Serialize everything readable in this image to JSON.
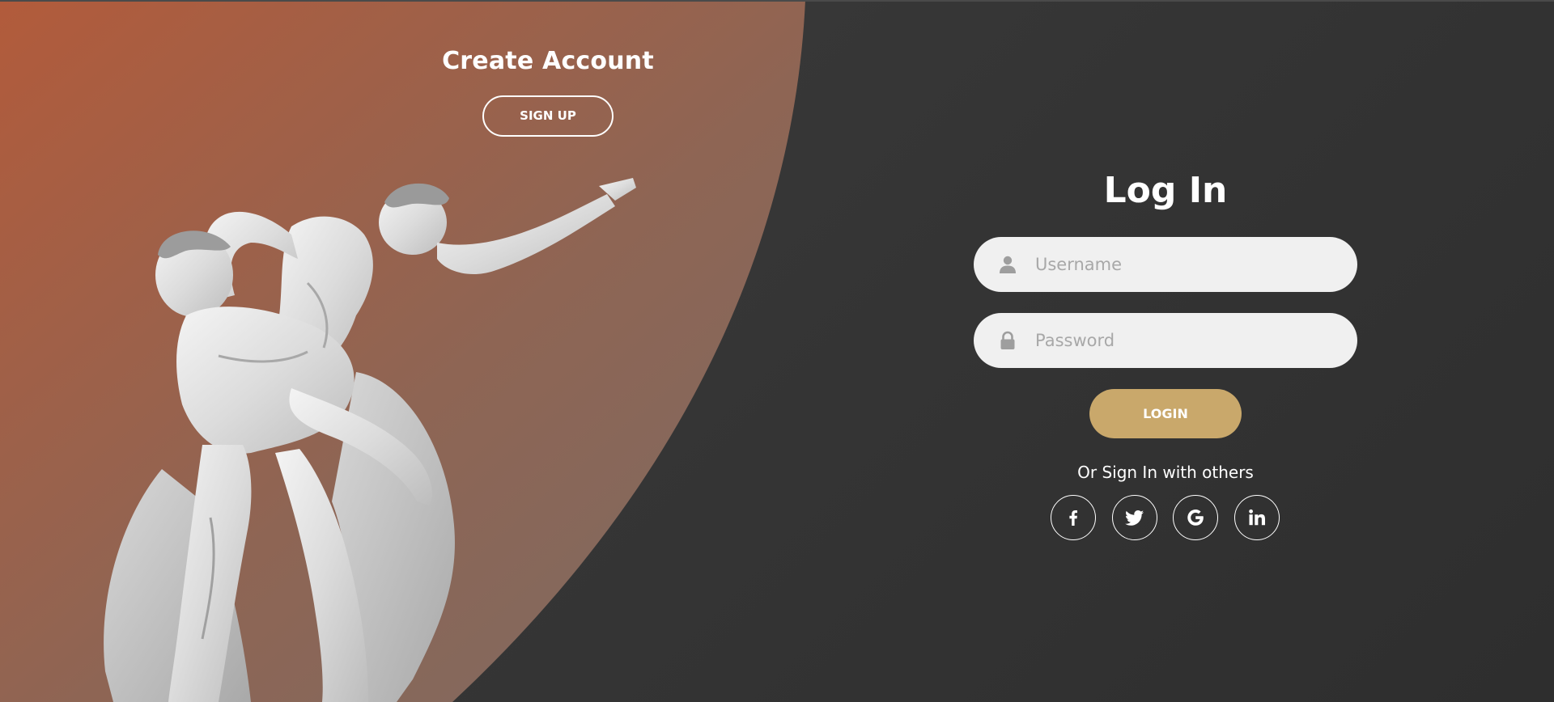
{
  "signup_panel": {
    "title": "Create Account",
    "button_label": "SIGN UP"
  },
  "login_panel": {
    "title": "Log In",
    "username_placeholder": "Username",
    "password_placeholder": "Password",
    "button_label": "LOGIN",
    "others_text": "Or Sign In with others",
    "social_buttons": [
      "facebook-icon",
      "twitter-icon",
      "google-icon",
      "linkedin-icon"
    ]
  },
  "colors": {
    "background": "#383838",
    "panel_gradient_start": "#b25b3b",
    "panel_gradient_end": "#7f6a62",
    "login_button": "#c9a86b",
    "input_background": "#f0f0f0"
  }
}
